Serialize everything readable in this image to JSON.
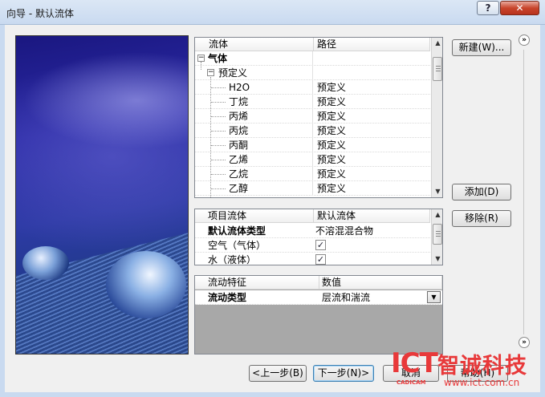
{
  "window": {
    "title": "向导 - 默认流体",
    "help_label": "?",
    "close_label": "✕"
  },
  "fluids": {
    "headers": [
      "流体",
      "路径"
    ],
    "gas_group": "气体",
    "predefined_group": "预定义",
    "rows": [
      {
        "name": "H2O",
        "path": "预定义"
      },
      {
        "name": "丁烷",
        "path": "预定义"
      },
      {
        "name": "丙烯",
        "path": "预定义"
      },
      {
        "name": "丙烷",
        "path": "预定义"
      },
      {
        "name": "丙酮",
        "path": "预定义"
      },
      {
        "name": "乙烯",
        "path": "预定义"
      },
      {
        "name": "乙烷",
        "path": "预定义"
      },
      {
        "name": "乙醇",
        "path": "预定义"
      }
    ]
  },
  "project_fluids": {
    "headers": [
      "项目流体",
      "默认流体"
    ],
    "type_label": "默认流体类型",
    "type_value": "不溶混混合物",
    "rows": [
      {
        "name": "空气（气体）",
        "checked": true
      },
      {
        "name": "水（液体）",
        "checked": true
      }
    ]
  },
  "flow": {
    "headers": [
      "流动特征",
      "数值"
    ],
    "type_label": "流动类型",
    "type_value": "层流和湍流"
  },
  "buttons": {
    "new": "新建(W)...",
    "add": "添加(D)",
    "remove": "移除(R)",
    "back": "<上一步(B)",
    "next": "下一步(N)>",
    "cancel": "取消",
    "help": "帮助(H)"
  },
  "watermark": {
    "ict": "ICT",
    "cadcam": "CADICAM",
    "brand": "智诚科技",
    "url": "www.ict.com.cn"
  },
  "icons": {
    "check": "✓",
    "scroll_up": "▲",
    "scroll_down": "▼",
    "expand": "»",
    "minus": "−",
    "dropdown": "▼"
  }
}
